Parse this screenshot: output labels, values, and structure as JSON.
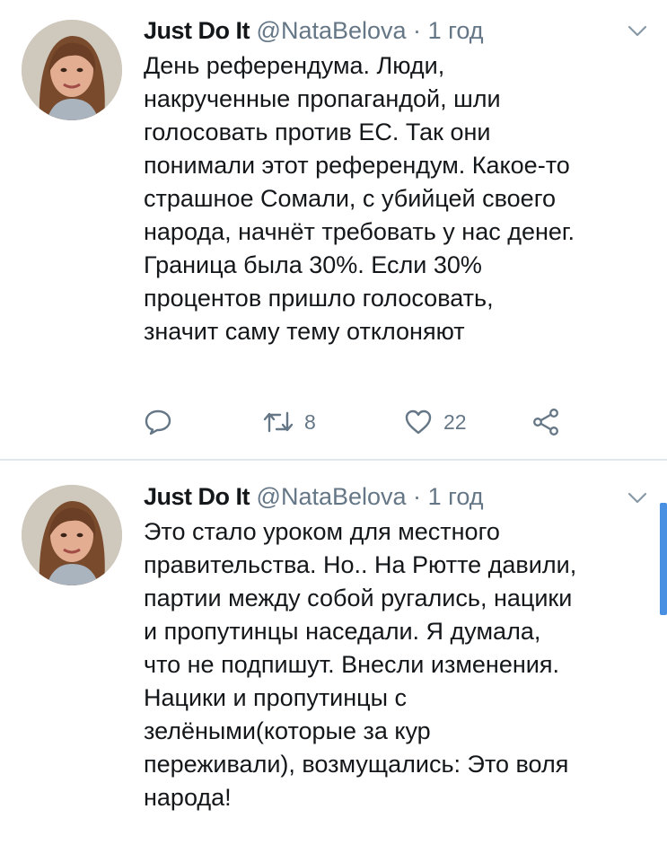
{
  "tweets": [
    {
      "author_name": "Just Do It",
      "handle": "@NataBelova",
      "separator": "·",
      "time": "1 год",
      "text": "День референдума. Люди,\nнакрученные пропагандой, шли\nголосовать против ЕС. Так они\nпонимали этот референдум. Какое-то\nстрашное Сомали, с убийцей своего\nнарода, начнёт требовать у нас денег.\nГраница была 30%. Если 30%\nпроцентов пришло голосовать,\nзначит саму тему отклоняют",
      "retweets": "8",
      "likes": "22"
    },
    {
      "author_name": "Just Do It",
      "handle": "@NataBelova",
      "separator": "·",
      "time": "1 год",
      "text": "Это стало уроком для местного\nправительства. Но.. На Рютте давили,\nпартии между собой ругались, нацики\nи пропутинцы наседали. Я думала,\nчто не подпишут. Внесли изменения.\nНацики и пропутинцы с\nзелёными(которые за кур\nпереживали), возмущались: Это воля\nнарода!"
    }
  ],
  "icons": {
    "reply": "reply-icon",
    "retweet": "retweet-icon",
    "like": "heart-icon",
    "share": "share-icon",
    "caret": "chevron-down-icon"
  },
  "colors": {
    "text": "#14171a",
    "secondary": "#657786",
    "divider": "#e1e8ed",
    "scrollbar": "#4a90e2"
  }
}
